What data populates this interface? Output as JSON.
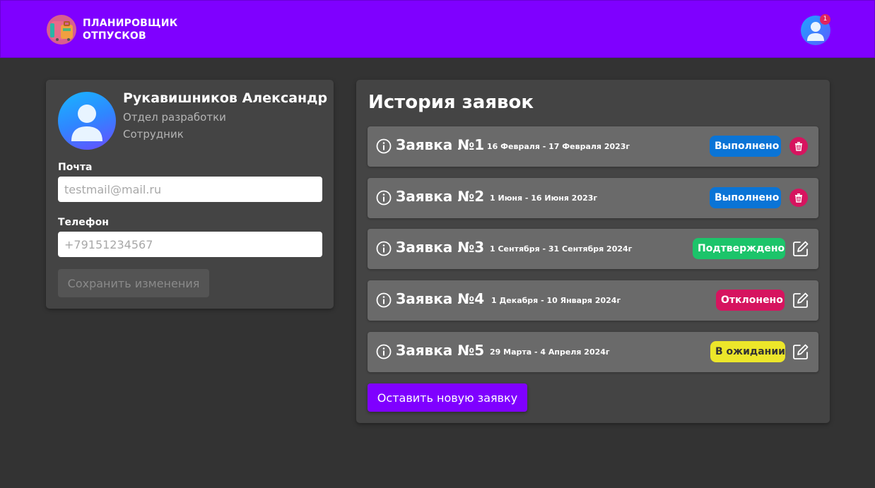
{
  "header": {
    "logo_line1": "ПЛАНИРОВЩИК",
    "logo_line2": "ОТПУСКОВ",
    "notification_count": "1",
    "logo_icon": "suitcase-icon",
    "avatar_icon": "user-avatar-icon"
  },
  "profile": {
    "name": "Рукавишников Александр",
    "department": "Отдел разработки",
    "role": "Сотрудник",
    "email_label": "Почта",
    "email_placeholder": "testmail@mail.ru",
    "phone_label": "Телефон",
    "phone_placeholder": "+79151234567",
    "save_label": "Сохранить изменения"
  },
  "history": {
    "title": "История заявок",
    "new_request_label": "Оставить новую заявку",
    "requests": [
      {
        "title": "Заявка №1",
        "dates": "16 Февраля - 17 Февраля 2023г",
        "status": "Выполнено",
        "action": "delete"
      },
      {
        "title": "Заявка №2",
        "dates": "1 Июня - 16 Июня 2023г",
        "status": "Выполнено",
        "action": "delete"
      },
      {
        "title": "Заявка №3",
        "dates": "1 Сентября - 31 Сентября 2024г",
        "status": "Подтверждено",
        "action": "edit"
      },
      {
        "title": "Заявка №4",
        "dates": "1 Декабря - 10 Января 2024г",
        "status": "Отклонено",
        "action": "edit"
      },
      {
        "title": "Заявка №5",
        "dates": "29 Марта - 4 Апреля 2024г",
        "status": "В ожидании",
        "action": "edit"
      }
    ]
  },
  "colors": {
    "accent": "#7f00ff",
    "done": "#0a74d6",
    "confirmed": "#1cc46a",
    "rejected": "#d6145f",
    "waiting": "#ece62a"
  }
}
